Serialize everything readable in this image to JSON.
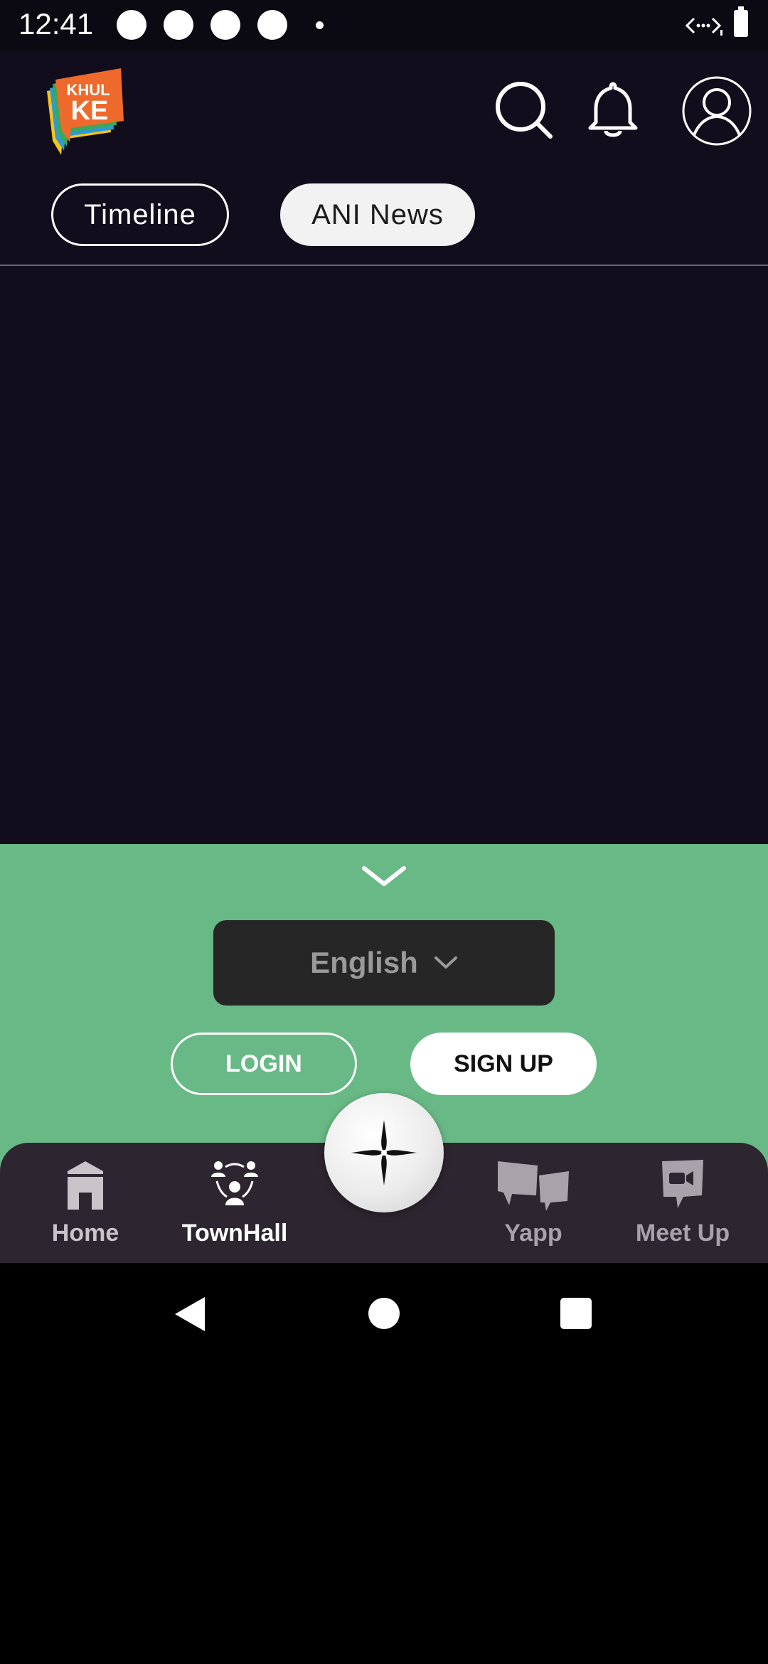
{
  "status_bar": {
    "time": "12:41"
  },
  "header": {
    "logo_text_top": "KHUL",
    "logo_text_bottom": "KE",
    "tabs": [
      {
        "label": "Timeline",
        "active": false
      },
      {
        "label": "ANI News",
        "active": true
      }
    ]
  },
  "auth_sheet": {
    "language": "English",
    "login_label": "LOGIN",
    "signup_label": "SIGN UP",
    "background_color": "#69b986"
  },
  "bottom_nav": {
    "items": [
      {
        "label": "Home",
        "icon": "home-icon"
      },
      {
        "label": "TownHall",
        "icon": "townhall-icon",
        "active": true
      },
      {
        "label": "Yapp",
        "icon": "yapp-icon"
      },
      {
        "label": "Meet Up",
        "icon": "meetup-icon"
      }
    ],
    "center_icon": "sparkle-icon"
  },
  "colors": {
    "background": "#120d1c",
    "nav_background": "#2d2630"
  }
}
